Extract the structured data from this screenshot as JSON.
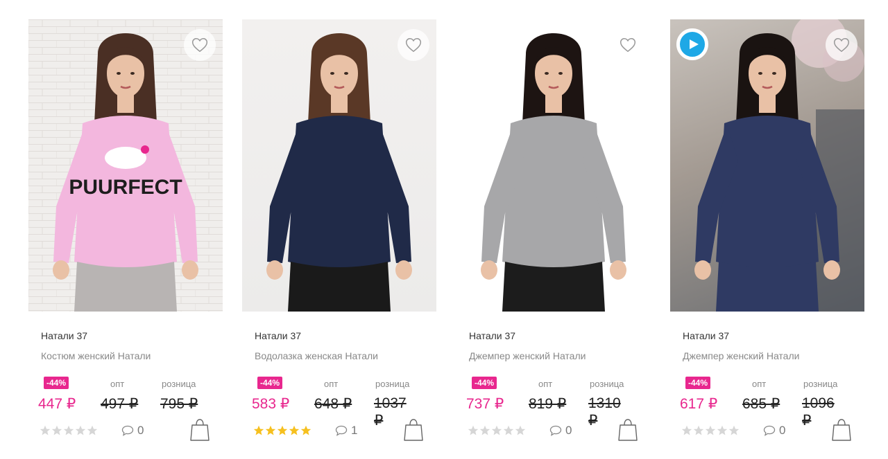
{
  "colors": {
    "accent": "#e8278e",
    "star_filled": "#f6c01f",
    "star_empty": "#d6d6d6",
    "play": "#1ea8e6"
  },
  "products": [
    {
      "brand": "Натали 37",
      "title": "Костюм женский Натали",
      "discount": "-44%",
      "opt_caption": "опт",
      "retail_caption": "розница",
      "price": "447 ₽",
      "opt_price": "497 ₽",
      "retail_price": "795 ₽",
      "rating": 0,
      "comments": "0",
      "has_video": false,
      "image": {
        "kind": "model",
        "name": "pink-tshirt-model-photo",
        "garment": "#f3b7de",
        "bottom": "#b8b4b3",
        "hair": "#4a2f24",
        "print": "PUURFECT"
      }
    },
    {
      "brand": "Натали 37",
      "title": "Водолазка женская Натали",
      "discount": "-44%",
      "opt_caption": "опт",
      "retail_caption": "розница",
      "price": "583 ₽",
      "opt_price": "648 ₽",
      "retail_price": "1037 ₽",
      "rating": 5,
      "comments": "1",
      "has_video": false,
      "image": {
        "kind": "model",
        "name": "navy-turtleneck-model-photo",
        "garment": "#202a48",
        "bottom": "#1a1a1a",
        "hair": "#5a3826",
        "print": ""
      }
    },
    {
      "brand": "Натали 37",
      "title": "Джемпер женский Натали",
      "discount": "-44%",
      "opt_caption": "опт",
      "retail_caption": "розница",
      "price": "737 ₽",
      "opt_price": "819 ₽",
      "retail_price": "1310 ₽",
      "rating": 0,
      "comments": "0",
      "has_video": false,
      "image": {
        "kind": "model",
        "name": "grey-jumper-model-photo",
        "garment": "#a7a7a9",
        "bottom": "#1c1c1c",
        "hair": "#1d1412",
        "print": ""
      }
    },
    {
      "brand": "Натали 37",
      "title": "Джемпер женский Натали",
      "discount": "-44%",
      "opt_caption": "опт",
      "retail_caption": "розница",
      "price": "617 ₽",
      "opt_price": "685 ₽",
      "retail_price": "1096 ₽",
      "rating": 0,
      "comments": "0",
      "has_video": true,
      "image": {
        "kind": "model",
        "name": "navy-knit-suit-model-photo",
        "garment": "#2f3a63",
        "bottom": "#2f3a63",
        "hair": "#1a1311",
        "print": ""
      }
    }
  ]
}
